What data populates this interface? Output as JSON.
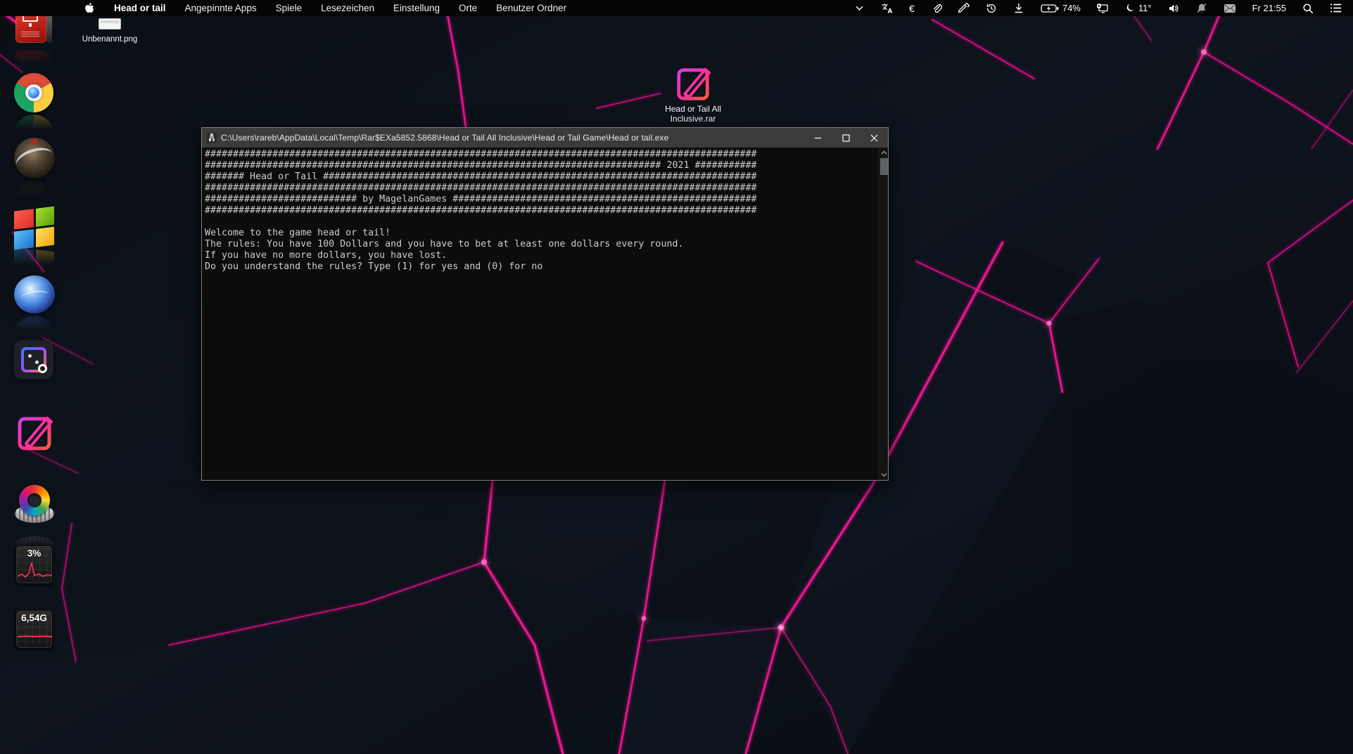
{
  "colors": {
    "accent_pink": "#ec1390",
    "console_bg": "#0c0c0c",
    "titlebar_bg": "#3b3b3b",
    "menubar_bg": "#050505"
  },
  "menubar": {
    "app_name": "Head or tail",
    "items": [
      "Angepinnte Apps",
      "Spiele",
      "Lesezeichen",
      "Einstellung",
      "Orte",
      "Benutzer Ordner"
    ],
    "battery": "74%",
    "temperature": "11°",
    "clock": "Fr 21:55",
    "euro_symbol": "€"
  },
  "desktop": {
    "file_label": "Unbenannt.png",
    "archive_label_line1": "Head or Tail  All",
    "archive_label_line2": "Inclusive.rar",
    "cpu_widget": "3%",
    "memory_widget": "6,54G"
  },
  "console": {
    "title": "C:\\Users\\rareb\\AppData\\Local\\Temp\\Rar$EXa5852.5868\\Head or Tail  All Inclusive\\Head or Tail Game\\Head or tail.exe",
    "body": [
      "##################################################################################################",
      "################################################################################# 2021 ###########",
      "####### Head or Tail #############################################################################",
      "##################################################################################################",
      "########################### by MagelanGames ######################################################",
      "##################################################################################################",
      "",
      "Welcome to the game head or tail!",
      "The rules: You have 100 Dollars and you have to bet at least one dollars every round.",
      "If you have no more dollars, you have lost.",
      "Do you understand the rules? Type (1) for yes and (0) for no"
    ]
  }
}
